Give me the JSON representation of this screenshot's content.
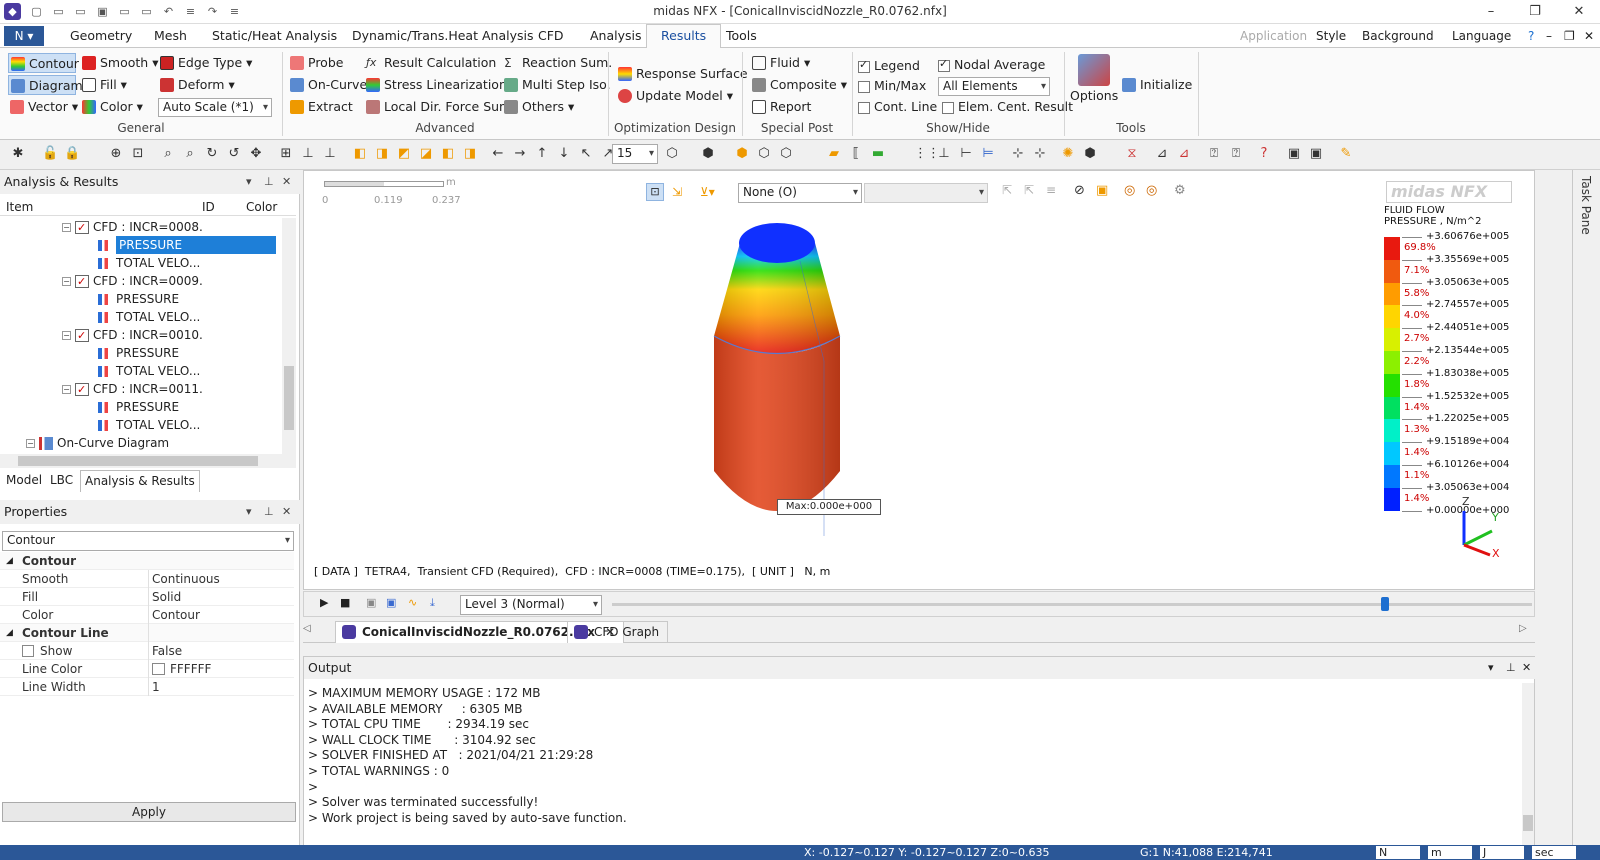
{
  "window": {
    "title": "midas NFX - [ConicalInviscidNozzle_R0.0762.nfx]"
  },
  "menu": {
    "items": [
      "Geometry",
      "Mesh",
      "Static/Heat Analysis",
      "Dynamic/Trans.Heat Analysis",
      "CFD",
      "Analysis",
      "Results",
      "Tools"
    ],
    "active": "Results",
    "right": [
      "Application",
      "Style",
      "Background",
      "Language"
    ]
  },
  "ribbon": {
    "general": {
      "contour": "Contour",
      "smooth": "Smooth",
      "edge_type": "Edge Type",
      "diagram": "Diagram",
      "fill": "Fill",
      "deform": "Deform",
      "vector": "Vector",
      "color": "Color",
      "auto_scale": "Auto Scale (*1)",
      "label": "General"
    },
    "advanced": {
      "probe": "Probe",
      "result_calc": "Result Calculation",
      "reaction_sum": "Reaction Sum.",
      "on_curve": "On-Curve",
      "stress_lin": "Stress Linearization",
      "multi_step": "Multi Step Iso.",
      "extract": "Extract",
      "local_dir": "Local Dir. Force Sum",
      "others": "Others",
      "label": "Advanced"
    },
    "opt": {
      "response_surface": "Response Surface",
      "update_model": "Update Model",
      "label": "Optimization Design"
    },
    "special": {
      "fluid": "Fluid",
      "composite": "Composite",
      "report": "Report",
      "label": "Special Post"
    },
    "show": {
      "legend": "Legend",
      "nodal_avg": "Nodal Average",
      "minmax": "Min/Max",
      "all_elements": "All Elements",
      "cont_line": "Cont. Line",
      "elem_cent": "Elem. Cent. Result",
      "label": "Show/Hide"
    },
    "tools": {
      "options": "Options",
      "initialize": "Initialize",
      "label": "Tools"
    }
  },
  "toolbar": {
    "step_value": "15"
  },
  "analysis_panel": {
    "title": "Analysis & Results",
    "columns": [
      "Item",
      "ID",
      "Color"
    ],
    "tree": [
      {
        "label": "CFD : INCR=0008.",
        "level": 1
      },
      {
        "label": "PRESSURE",
        "level": 2,
        "selected": true
      },
      {
        "label": "TOTAL VELO...",
        "level": 2
      },
      {
        "label": "CFD : INCR=0009.",
        "level": 1
      },
      {
        "label": "PRESSURE",
        "level": 2
      },
      {
        "label": "TOTAL VELO...",
        "level": 2
      },
      {
        "label": "CFD : INCR=0010.",
        "level": 1
      },
      {
        "label": "PRESSURE",
        "level": 2
      },
      {
        "label": "TOTAL VELO...",
        "level": 2
      },
      {
        "label": "CFD : INCR=0011.",
        "level": 1
      },
      {
        "label": "PRESSURE",
        "level": 2
      },
      {
        "label": "TOTAL VELO...",
        "level": 2
      },
      {
        "label": "On-Curve Diagram",
        "level": 0
      }
    ],
    "tabs": [
      "Model",
      "LBC",
      "Analysis & Results"
    ]
  },
  "properties": {
    "title": "Properties",
    "selector": "Contour",
    "rows": [
      {
        "key": "Contour",
        "cat": true
      },
      {
        "key": "Smooth",
        "value": "Continuous"
      },
      {
        "key": "Fill",
        "value": "Solid"
      },
      {
        "key": "Color",
        "value": "Contour"
      },
      {
        "key": "Contour Line",
        "cat": true
      },
      {
        "key": "Show",
        "value": "False"
      },
      {
        "key": "Line Color",
        "value": "FFFFFF"
      },
      {
        "key": "Line Width",
        "value": "1"
      }
    ],
    "apply": "Apply"
  },
  "viewport": {
    "scale_ticks": [
      "0",
      "0.119",
      "0.237"
    ],
    "scale_unit": "m",
    "filter_select": "None (O)",
    "brand": "midas NFX",
    "legend_title1": "FLUID FLOW",
    "legend_title2": "PRESSURE , N/m^2",
    "legend_values": [
      "+3.60676e+005",
      "+3.35569e+005",
      "+3.05063e+005",
      "+2.74557e+005",
      "+2.44051e+005",
      "+2.13544e+005",
      "+1.83038e+005",
      "+1.52532e+005",
      "+1.22025e+005",
      "+9.15189e+004",
      "+6.10126e+004",
      "+3.05063e+004",
      "+0.00000e+000"
    ],
    "legend_percents": [
      "69.8%",
      "7.1%",
      "5.8%",
      "4.0%",
      "2.7%",
      "2.2%",
      "1.8%",
      "1.4%",
      "1.3%",
      "1.4%",
      "1.1%",
      "1.4%"
    ],
    "legend_colors": [
      "#e8190f",
      "#f05a0f",
      "#ff9c00",
      "#ffd500",
      "#d8f000",
      "#8cf000",
      "#24e000",
      "#00e060",
      "#00f0c8",
      "#00c8ff",
      "#0078ff",
      "#0020ff"
    ],
    "minmax_label": "Max:0.000e+000",
    "info": "[ DATA ]  TETRA4,  Transient CFD (Required),  CFD : INCR=0008 (TIME=0.175),  [ UNIT ]   N, m",
    "axis": {
      "x": "X",
      "y": "Y",
      "z": "Z"
    }
  },
  "bottom": {
    "level": "Level 3 (Normal)",
    "slider": 0.84
  },
  "doc_tabs": [
    "ConicalInviscidNozzle_R0.0762.nfx",
    "CFD Graph"
  ],
  "output": {
    "title": "Output",
    "lines": [
      "> MAXIMUM MEMORY USAGE : 172 MB",
      "> AVAILABLE MEMORY     : 6305 MB",
      "> TOTAL CPU TIME       : 2934.19 sec",
      "> WALL CLOCK TIME      : 3104.92 sec",
      "> SOLVER FINISHED AT   : 2021/04/21 21:29:28",
      "> TOTAL WARNINGS : 0",
      ">",
      "> Solver was terminated successfully!",
      "> Work project is being saved by auto-save function."
    ]
  },
  "status": {
    "coords": "X: -0.127~0.127 Y: -0.127~0.127 Z:0~0.635",
    "info": "G:1  N:41,088  E:214,741",
    "units": [
      "N",
      "m",
      "J",
      "sec"
    ]
  },
  "task_pane": "Task Pane"
}
